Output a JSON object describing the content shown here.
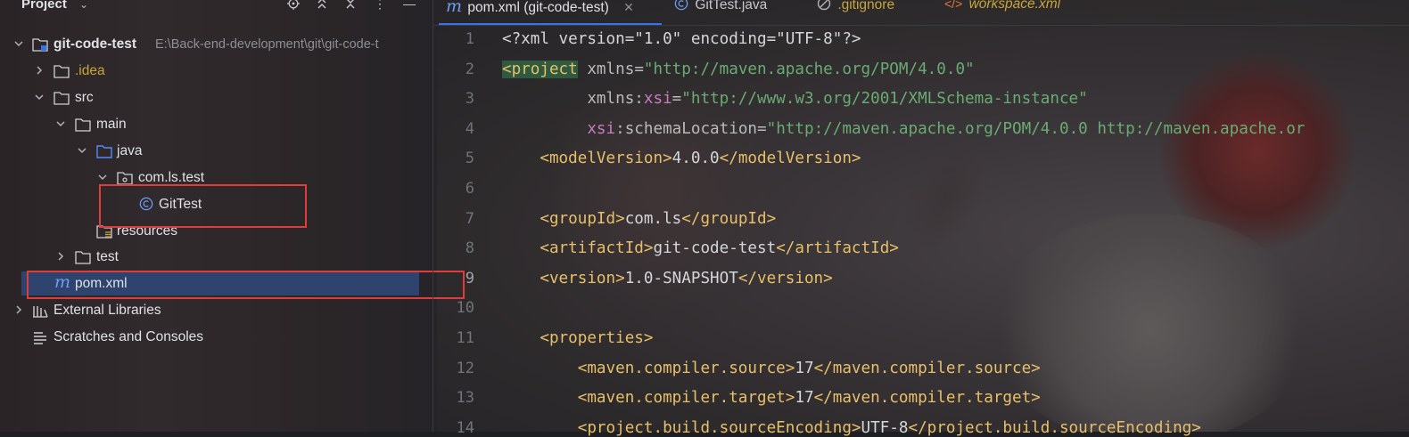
{
  "sidebar": {
    "title": "Project",
    "tree": [
      {
        "label": "git-code-test",
        "path": "E:\\Back-end-development\\git\\git-code-t"
      },
      {
        "label": ".idea"
      },
      {
        "label": "src"
      },
      {
        "label": "main"
      },
      {
        "label": "java"
      },
      {
        "label": "com.ls.test"
      },
      {
        "label": "GitTest"
      },
      {
        "label": "resources"
      },
      {
        "label": "test"
      },
      {
        "label": "pom.xml"
      },
      {
        "label": "External Libraries"
      },
      {
        "label": "Scratches and Consoles"
      }
    ]
  },
  "tabs": [
    {
      "label": "pom.xml (git-code-test)",
      "icon": "maven-icon"
    },
    {
      "label": "GitTest.java",
      "icon": "class-icon"
    },
    {
      "label": ".gitignore",
      "icon": "ignore-icon"
    },
    {
      "label": "workspace.xml",
      "icon": "xml-icon"
    }
  ],
  "editor": {
    "line_numbers": [
      "1",
      "2",
      "3",
      "4",
      "5",
      "6",
      "7",
      "8",
      "9",
      "10",
      "11",
      "12",
      "13",
      "14"
    ],
    "lines": [
      [
        [
          "<?xml version=\"1.0\" encoding=\"UTF-8\"?>",
          "pi"
        ]
      ],
      [
        [
          "<project",
          "tag-hl"
        ],
        [
          " xmlns",
          "attr"
        ],
        [
          "=",
          "attr"
        ],
        [
          "\"http://maven.apache.org/POM/4.0.0\"",
          "str"
        ]
      ],
      [
        [
          "         xmlns",
          "attr"
        ],
        [
          ":",
          "attr"
        ],
        [
          "xsi",
          "ns"
        ],
        [
          "=",
          "attr"
        ],
        [
          "\"http://www.w3.org/2001/XMLSchema-instance\"",
          "str"
        ]
      ],
      [
        [
          "         ",
          "txt"
        ],
        [
          "xsi",
          "ns"
        ],
        [
          ":schemaLocation",
          "attr"
        ],
        [
          "=",
          "attr"
        ],
        [
          "\"http://maven.apache.org/POM/4.0.0 http://maven.apache.or",
          "str"
        ]
      ],
      [
        [
          "    <modelVersion>",
          "tag"
        ],
        [
          "4.0.0",
          "txt"
        ],
        [
          "</modelVersion>",
          "tag"
        ]
      ],
      [
        [
          "",
          "txt"
        ]
      ],
      [
        [
          "    <groupId>",
          "tag"
        ],
        [
          "com.ls",
          "txt"
        ],
        [
          "</groupId>",
          "tag"
        ]
      ],
      [
        [
          "    <artifactId>",
          "tag"
        ],
        [
          "git-code-test",
          "txt"
        ],
        [
          "</artifactId>",
          "tag"
        ]
      ],
      [
        [
          "    <version>",
          "tag"
        ],
        [
          "1.0-SNAPSHOT",
          "txt"
        ],
        [
          "</version>",
          "tag"
        ]
      ],
      [
        [
          "",
          "txt"
        ]
      ],
      [
        [
          "    <properties>",
          "tag"
        ]
      ],
      [
        [
          "        <maven.compiler.source>",
          "tag"
        ],
        [
          "17",
          "txt"
        ],
        [
          "</maven.compiler.source>",
          "tag"
        ]
      ],
      [
        [
          "        <maven.compiler.target>",
          "tag"
        ],
        [
          "17",
          "txt"
        ],
        [
          "</maven.compiler.target>",
          "tag"
        ]
      ],
      [
        [
          "        <project.build.sourceEncoding>",
          "tag"
        ],
        [
          "UTF-8",
          "txt"
        ],
        [
          "</project.build.sourceEncoding>",
          "tag"
        ]
      ]
    ]
  },
  "colors": {
    "accent": "#3574f0",
    "annotation": "#e03c3c",
    "tag": "#e8bf6a",
    "string": "#6aab73",
    "namespace": "#c77dbb"
  }
}
